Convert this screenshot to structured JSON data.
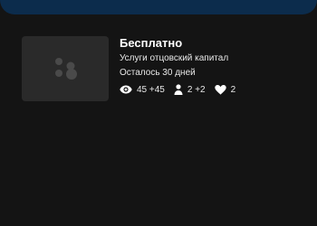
{
  "listing": {
    "title": "Бесплатно",
    "service": "Услуги отцовский капитал",
    "remaining": "Осталось 30 дней",
    "stats": {
      "views": "45 +45",
      "contacts": "2 +2",
      "favorites": "2"
    },
    "icons": {
      "placeholder": "image-placeholder-icon",
      "views": "eye-icon",
      "contacts": "person-icon",
      "favorites": "heart-icon"
    }
  },
  "colors": {
    "background": "#141414",
    "banner": "#0c2c4c",
    "thumbnail": "#2a2a2a",
    "placeholder_dots": "#4a4a4a",
    "text": "#ffffff"
  }
}
